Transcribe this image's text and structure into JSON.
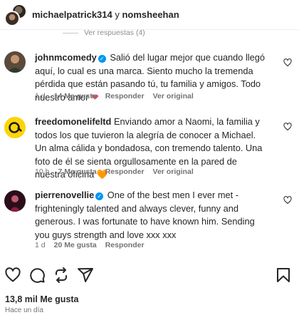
{
  "header": {
    "user1": "michaelpatrick314",
    "sep": "y",
    "user2": "nomsheehan"
  },
  "replies_label": "Ver respuestas (4)",
  "comments": [
    {
      "username": "johnmcomedy",
      "verified": true,
      "text": "Salió del lugar mejor que cuando llegó aquí, lo cual es una marca. Siento mucho la tremenda pérdida que están pasando tú, tu familia y amigos. Todo nuestro amor",
      "emoji": "❤",
      "time": "1 d",
      "likes": "14 Me gusta",
      "reply": "Responder",
      "translate": "Ver original"
    },
    {
      "username": "freedomonelifeltd",
      "verified": false,
      "text": "Enviando amor a Naomi, la familia y todos los que tuvieron la alegría de conocer a Michael. Un alma cálida y bondadosa, con tremendo talento. Una foto de él se sienta orgullosamente en la pared de nuestra oficina",
      "emoji": "🧡",
      "time": "10 h",
      "likes": "7 Me gusta",
      "reply": "Responder",
      "translate": "Ver original"
    },
    {
      "username": "pierrenovellie",
      "verified": true,
      "text": "One of the best men I ever met - frighteningly talented and always clever, funny and generous. I was fortunate to have known him. Sending you guys strength and love xxx xxx",
      "time": "1 d",
      "likes": "20 Me gusta",
      "reply": "Responder"
    }
  ],
  "post": {
    "likes": "13,8 mil Me gusta",
    "time": "Hace un día"
  },
  "icons": [
    "heart-icon",
    "comment-icon",
    "repost-icon",
    "share-icon",
    "bookmark-icon"
  ]
}
